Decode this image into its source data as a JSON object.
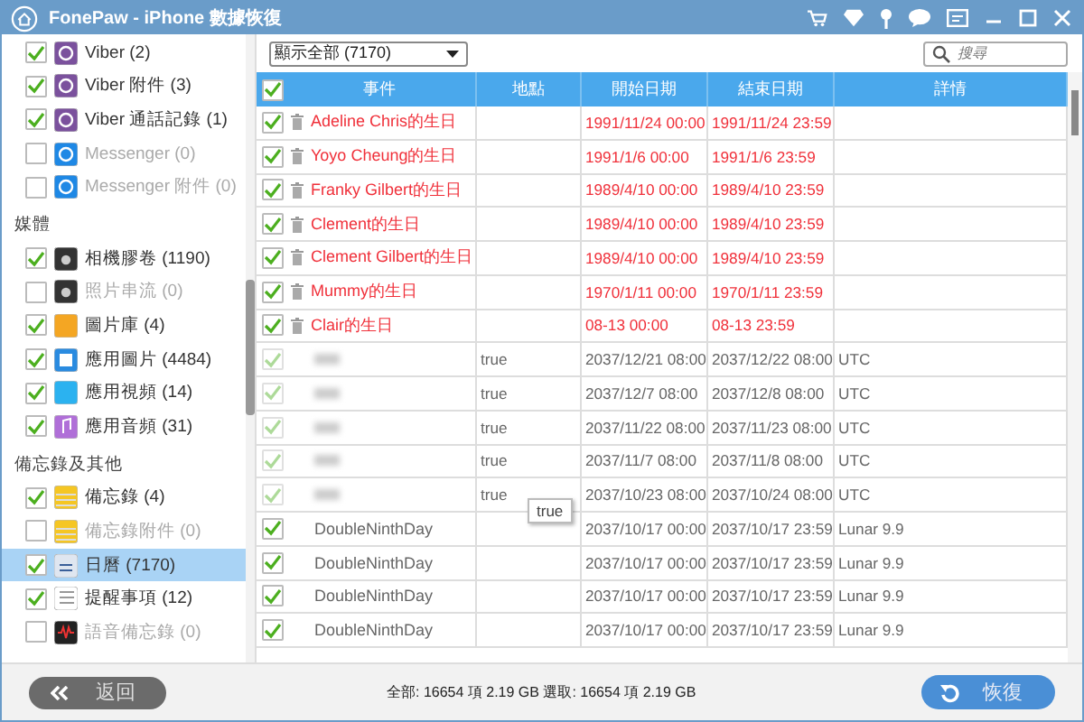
{
  "window": {
    "title": "FonePaw - iPhone 數據恢復"
  },
  "sidebar": {
    "groups": [
      {
        "items": [
          {
            "label": "Viber (2)",
            "checked": true,
            "disabled": false,
            "selected": false,
            "kind": "viber"
          },
          {
            "label": "Viber 附件 (3)",
            "checked": true,
            "disabled": false,
            "selected": false,
            "kind": "viber"
          },
          {
            "label": "Viber 通話記錄 (1)",
            "checked": true,
            "disabled": false,
            "selected": false,
            "kind": "viber"
          },
          {
            "label": "Messenger (0)",
            "checked": false,
            "disabled": true,
            "selected": false,
            "kind": "messenger"
          },
          {
            "label": "Messenger 附件 (0)",
            "checked": false,
            "disabled": true,
            "selected": false,
            "kind": "messenger"
          }
        ]
      },
      {
        "heading": "媒體",
        "items": [
          {
            "label": "相機膠卷 (1190)",
            "checked": true,
            "disabled": false,
            "selected": false,
            "kind": "camera"
          },
          {
            "label": "照片串流 (0)",
            "checked": false,
            "disabled": true,
            "selected": false,
            "kind": "camera"
          },
          {
            "label": "圖片庫 (4)",
            "checked": true,
            "disabled": false,
            "selected": false,
            "kind": "photos"
          },
          {
            "label": "應用圖片 (4484)",
            "checked": true,
            "disabled": false,
            "selected": false,
            "kind": "image"
          },
          {
            "label": "應用視頻 (14)",
            "checked": true,
            "disabled": false,
            "selected": false,
            "kind": "video"
          },
          {
            "label": "應用音頻 (31)",
            "checked": true,
            "disabled": false,
            "selected": false,
            "kind": "music"
          }
        ]
      },
      {
        "heading": "備忘錄及其他",
        "items": [
          {
            "label": "備忘錄 (4)",
            "checked": true,
            "disabled": false,
            "selected": false,
            "kind": "notes"
          },
          {
            "label": "備忘錄附件 (0)",
            "checked": false,
            "disabled": true,
            "selected": false,
            "kind": "notes"
          },
          {
            "label": "日曆 (7170)",
            "checked": true,
            "disabled": false,
            "selected": true,
            "kind": "calendar"
          },
          {
            "label": "提醒事項 (12)",
            "checked": true,
            "disabled": false,
            "selected": false,
            "kind": "list"
          },
          {
            "label": "語音備忘錄 (0)",
            "checked": false,
            "disabled": true,
            "selected": false,
            "kind": "voice"
          }
        ]
      }
    ]
  },
  "filter": {
    "value": "顯示全部 (7170)"
  },
  "search": {
    "placeholder": "搜尋"
  },
  "table": {
    "all_checked": true,
    "columns": [
      "事件",
      "地點",
      "開始日期",
      "結束日期",
      "詳情"
    ],
    "rows": [
      {
        "kind": "deleted",
        "checked": true,
        "event": "Adeline Chris的生日",
        "start": "1991/11/24 00:00",
        "end": "1991/11/24 23:59"
      },
      {
        "kind": "deleted",
        "checked": true,
        "event": "Yoyo Cheung的生日",
        "start": "1991/1/6 00:00",
        "end": "1991/1/6 23:59"
      },
      {
        "kind": "deleted",
        "checked": true,
        "event": "Franky Gilbert的生日",
        "start": "1989/4/10 00:00",
        "end": "1989/4/10 23:59"
      },
      {
        "kind": "deleted",
        "checked": true,
        "event": "Clement的生日",
        "start": "1989/4/10 00:00",
        "end": "1989/4/10 23:59"
      },
      {
        "kind": "deleted",
        "checked": true,
        "event": "Clement Gilbert的生日",
        "start": "1989/4/10 00:00",
        "end": "1989/4/10 23:59"
      },
      {
        "kind": "deleted",
        "checked": true,
        "event": "Mummy的生日",
        "start": "1970/1/11 00:00",
        "end": "1970/1/11 23:59"
      },
      {
        "kind": "deleted",
        "checked": true,
        "event": "Clair的生日",
        "start": "08-13 00:00",
        "end": "08-13 23:59"
      },
      {
        "kind": "blurred",
        "checked": true,
        "location": "true",
        "start": "2037/12/21 08:00",
        "end": "2037/12/22 08:00",
        "detail": "UTC"
      },
      {
        "kind": "blurred",
        "checked": true,
        "location": "true",
        "start": "2037/12/7 08:00",
        "end": "2037/12/8 08:00",
        "detail": "UTC"
      },
      {
        "kind": "blurred",
        "checked": true,
        "location": "true",
        "start": "2037/11/22 08:00",
        "end": "2037/11/23 08:00",
        "detail": "UTC"
      },
      {
        "kind": "blurred",
        "checked": true,
        "location": "true",
        "start": "2037/11/7 08:00",
        "end": "2037/11/8 08:00",
        "detail": "UTC"
      },
      {
        "kind": "blurred",
        "checked": true,
        "location": "true",
        "start": "2037/10/23 08:00",
        "end": "2037/10/24 08:00",
        "detail": "UTC"
      },
      {
        "kind": "normal",
        "checked": true,
        "event": "DoubleNinthDay",
        "start": "2037/10/17 00:00",
        "end": "2037/10/17 23:59",
        "detail": "Lunar 9.9"
      },
      {
        "kind": "normal",
        "checked": true,
        "event": "DoubleNinthDay",
        "start": "2037/10/17 00:00",
        "end": "2037/10/17 23:59",
        "detail": "Lunar 9.9"
      },
      {
        "kind": "normal",
        "checked": true,
        "event": "DoubleNinthDay",
        "start": "2037/10/17 00:00",
        "end": "2037/10/17 23:59",
        "detail": "Lunar 9.9"
      },
      {
        "kind": "normal",
        "checked": true,
        "event": "DoubleNinthDay",
        "start": "2037/10/17 00:00",
        "end": "2037/10/17 23:59",
        "detail": "Lunar 9.9"
      }
    ]
  },
  "tooltip": {
    "text": "true"
  },
  "footer": {
    "back": "返回",
    "status": "全部: 16654 項 2.19 GB 選取: 16654 項 2.19 GB",
    "recover": "恢復"
  }
}
